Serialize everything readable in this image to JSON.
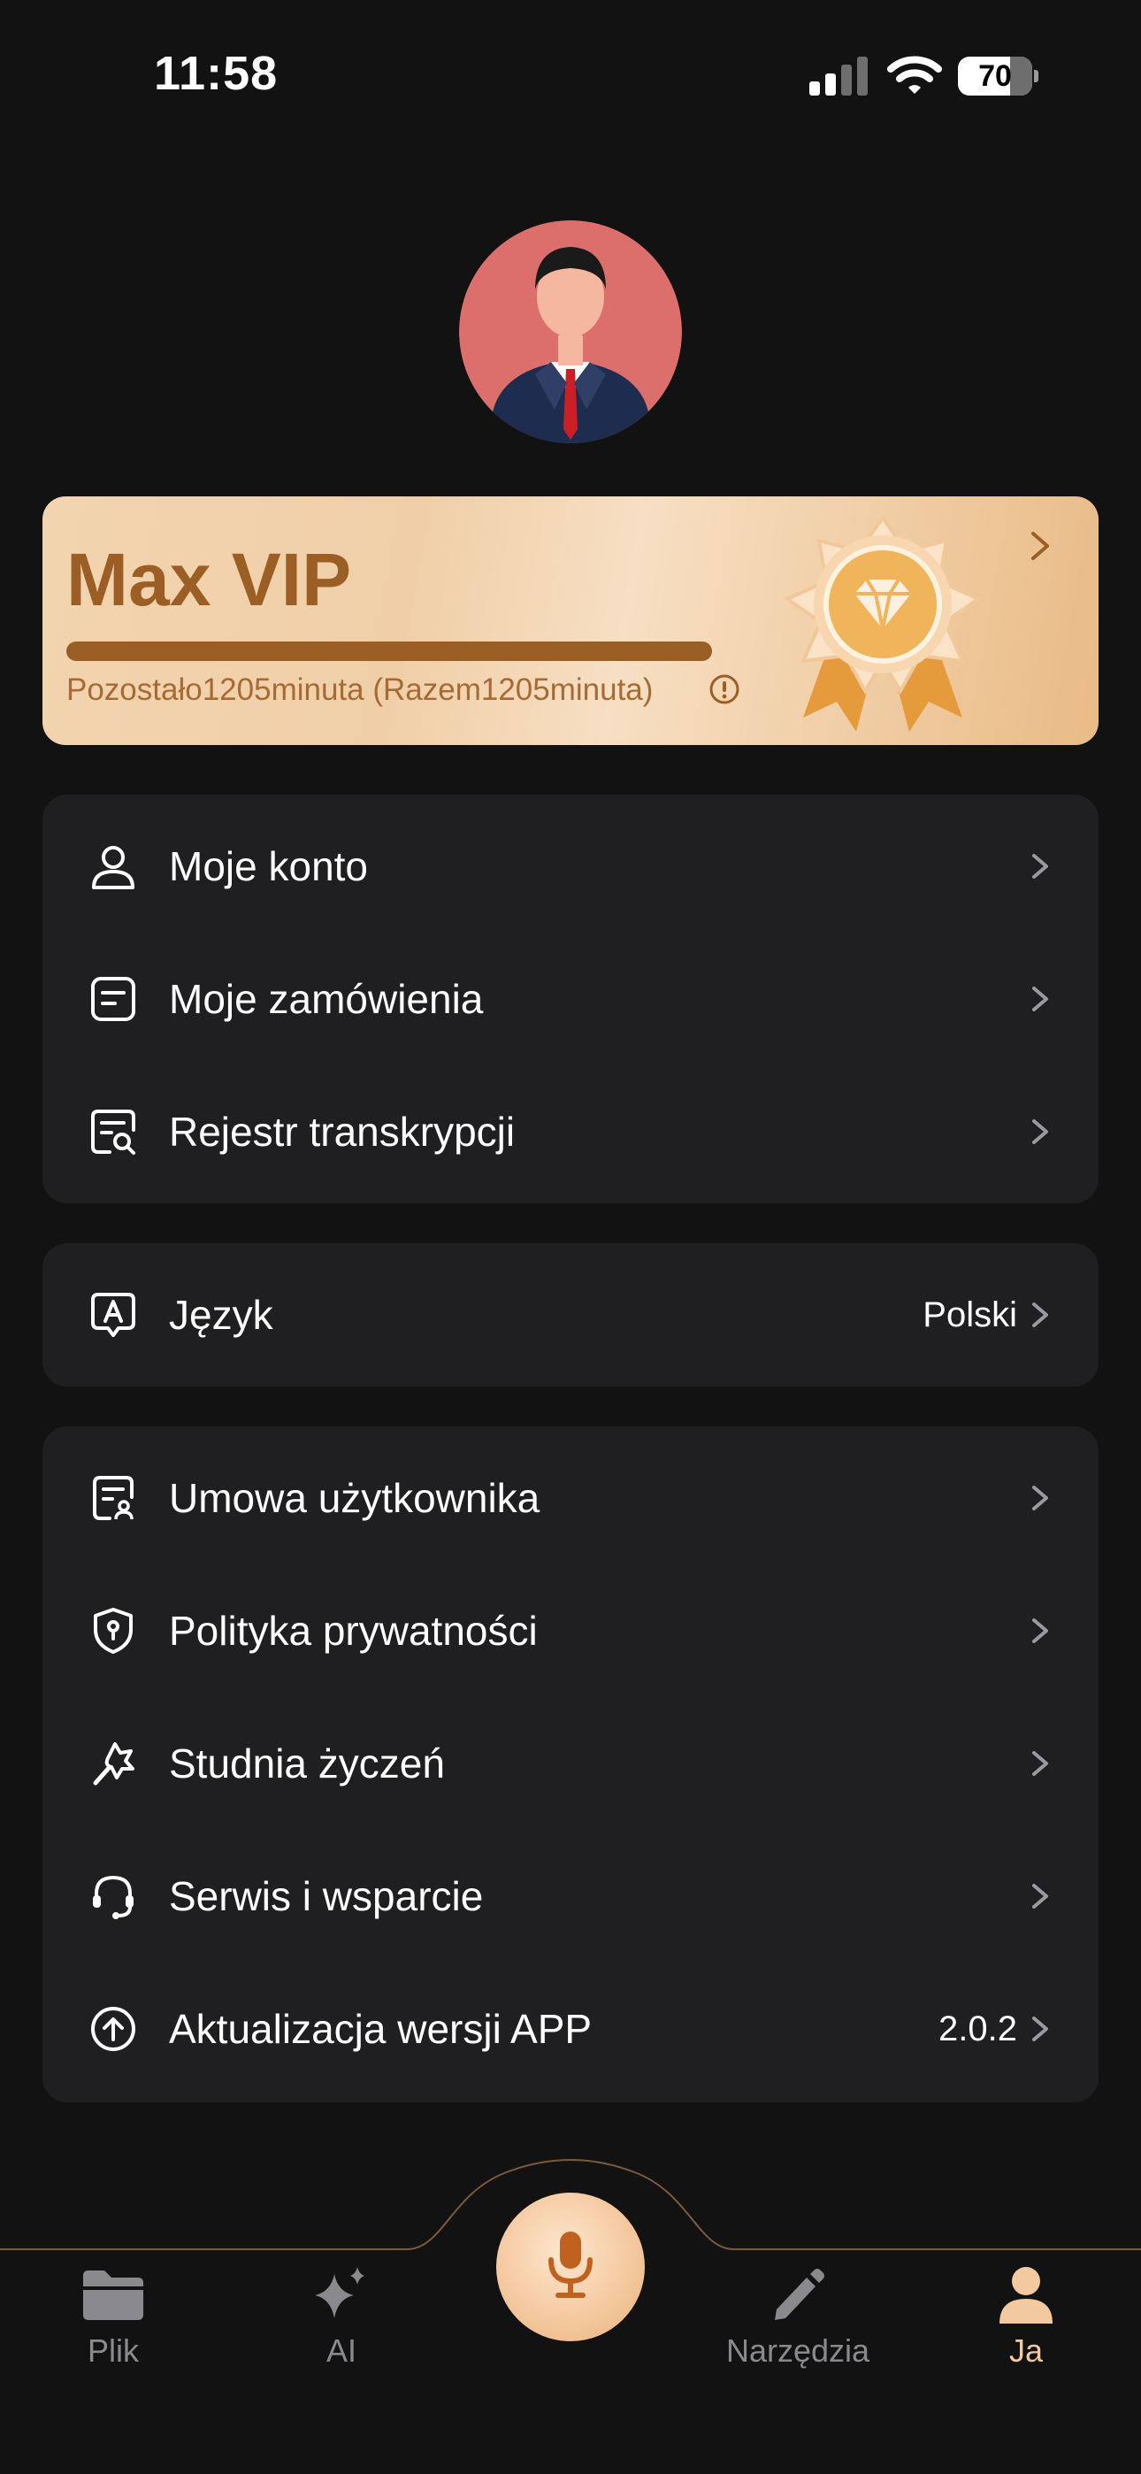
{
  "status_bar": {
    "time": "11:58",
    "battery": "70"
  },
  "vip": {
    "title": "Max VIP",
    "remaining_text": "Pozostało1205minuta (Razem1205minuta)",
    "progress": 1.0
  },
  "account_section": [
    {
      "label": "Moje konto",
      "icon": "user-icon"
    },
    {
      "label": "Moje zamówienia",
      "icon": "orders-icon"
    },
    {
      "label": "Rejestr transkrypcji",
      "icon": "transcript-search-icon"
    }
  ],
  "language": {
    "label": "Język",
    "value": "Polski",
    "icon": "language-icon"
  },
  "info_section": [
    {
      "label": "Umowa użytkownika",
      "icon": "agreement-icon"
    },
    {
      "label": "Polityka prywatności",
      "icon": "shield-icon"
    },
    {
      "label": "Studnia życzeń",
      "icon": "wish-icon"
    },
    {
      "label": "Serwis i wsparcie",
      "icon": "headset-icon"
    },
    {
      "label": "Aktualizacja wersji APP",
      "icon": "upload-icon",
      "value": "2.0.2"
    }
  ],
  "tabs": [
    {
      "label": "Plik",
      "icon": "folder-icon",
      "active": false
    },
    {
      "label": "AI",
      "icon": "sparkle-icon",
      "active": false
    },
    {
      "label": "Narzędzia",
      "icon": "pencil-icon",
      "active": false
    },
    {
      "label": "Ja",
      "icon": "person-icon",
      "active": true
    }
  ],
  "colors": {
    "background": "#121212",
    "card": "#1f1f21",
    "accent": "#f3c9a0",
    "vip_text": "#9b5e24",
    "tab_inactive": "#8a8a8e"
  }
}
